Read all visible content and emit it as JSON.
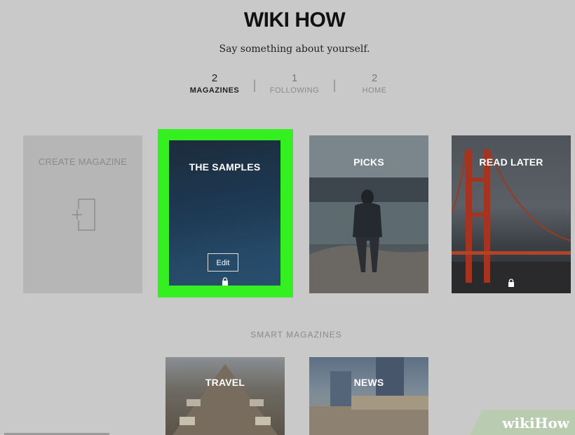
{
  "profile": {
    "name": "WIKI HOW",
    "bio": "Say something about yourself."
  },
  "stats": [
    {
      "count": "2",
      "label": "MAGAZINES"
    },
    {
      "count": "1",
      "label": "FOLLOWING"
    },
    {
      "count": "2",
      "label": "HOME"
    }
  ],
  "magazines": {
    "create_label": "CREATE MAGAZINE",
    "items": [
      {
        "title": "THE SAMPLES",
        "edit_label": "Edit"
      },
      {
        "title": "PICKS"
      },
      {
        "title": "READ LATER"
      }
    ]
  },
  "smart_magazines": {
    "heading": "SMART MAGAZINES",
    "items": [
      {
        "title": "TRAVEL"
      },
      {
        "title": "NEWS"
      }
    ]
  },
  "watermark": {
    "text_wiki": "wiki",
    "text_how": "How"
  },
  "colors": {
    "highlight": "#35f020",
    "background": "#c9c9c9"
  },
  "icons": [
    "add-page-icon",
    "lock-icon"
  ]
}
